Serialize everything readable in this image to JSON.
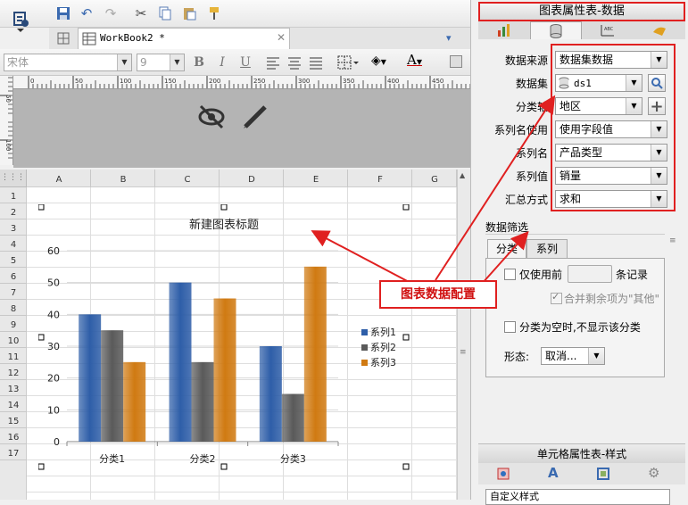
{
  "toolbar": {
    "tab_label": "WorkBook2 *",
    "font_name": "宋体",
    "font_size": "9",
    "bold": "B",
    "italic": "I",
    "underline": "U"
  },
  "ruler": {
    "ticks": [
      "0",
      "50",
      "100",
      "150",
      "200",
      "250",
      "300",
      "350",
      "400",
      "450"
    ],
    "vticks": [
      "50",
      "100"
    ]
  },
  "sheet": {
    "columns": [
      "A",
      "B",
      "C",
      "D",
      "E",
      "F",
      "G"
    ],
    "rows": [
      "1",
      "2",
      "3",
      "4",
      "5",
      "6",
      "7",
      "8",
      "9",
      "10",
      "11",
      "12",
      "13",
      "14",
      "15",
      "16",
      "17"
    ]
  },
  "chart_data": {
    "type": "bar",
    "title": "新建图表标题",
    "categories": [
      "分类1",
      "分类2",
      "分类3"
    ],
    "series": [
      {
        "name": "系列1",
        "values": [
          40,
          50,
          30
        ],
        "color": "#2e5ea8"
      },
      {
        "name": "系列2",
        "values": [
          35,
          25,
          15
        ],
        "color": "#5a5a5a"
      },
      {
        "name": "系列3",
        "values": [
          25,
          45,
          55
        ],
        "color": "#d07a12"
      }
    ],
    "ylim": [
      0,
      60
    ],
    "yticks": [
      "0",
      "10",
      "20",
      "30",
      "40",
      "50",
      "60"
    ],
    "grid": true,
    "legend": "right"
  },
  "panel": {
    "title": "图表属性表-数据",
    "fields": [
      {
        "label": "数据来源",
        "value": "数据集数据"
      },
      {
        "label": "数据集",
        "value": "ds1"
      },
      {
        "label": "分类轴",
        "value": "地区"
      },
      {
        "label": "系列名使用",
        "value": "使用字段值"
      },
      {
        "label": "系列名",
        "value": "产品类型"
      },
      {
        "label": "系列值",
        "value": "销量"
      },
      {
        "label": "汇总方式",
        "value": "求和"
      }
    ],
    "filter": {
      "title": "数据筛选",
      "tabs": [
        "分类",
        "系列"
      ],
      "only_use_front": "仅使用前",
      "records": "条记录",
      "merge_rest": "合并剩余项为\"其他\"",
      "hide_empty": "分类为空时,不显示该分类",
      "shape_label": "形态:",
      "shape_value": "取消..."
    },
    "callout": "图表数据配置",
    "lower_title": "单元格属性表-样式",
    "lower_combo": "自定义样式"
  },
  "colors": {
    "accent_red": "#e02020",
    "series1": "#2e5ea8",
    "series2": "#5a5a5a",
    "series3": "#d07a12"
  }
}
